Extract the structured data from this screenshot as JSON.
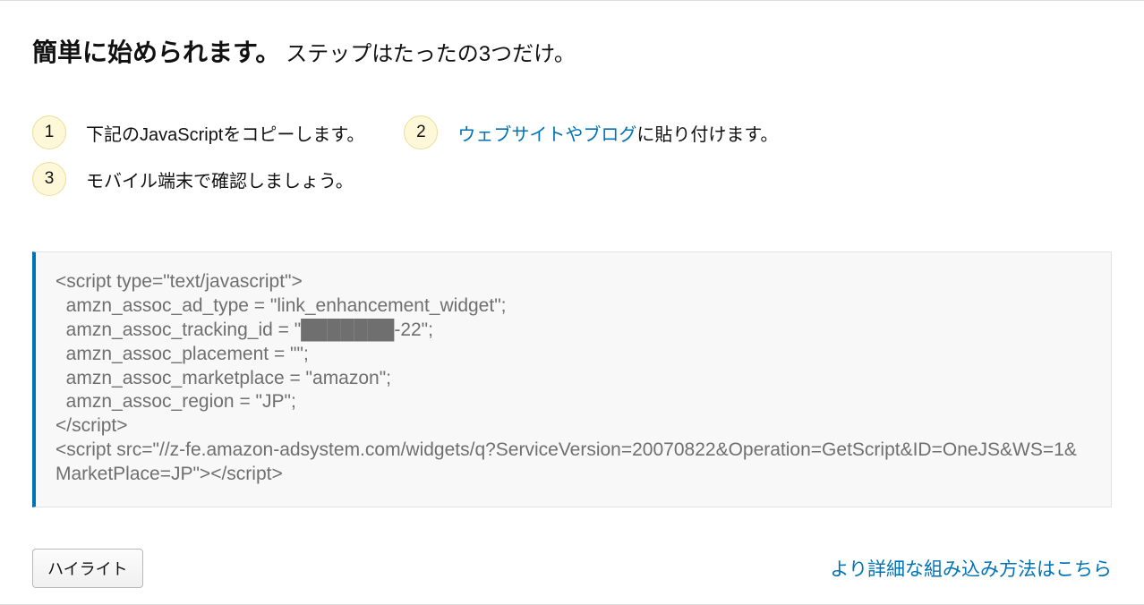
{
  "heading": {
    "main": "簡単に始められます。",
    "sub": "ステップはたったの3つだけ。"
  },
  "steps": {
    "s1": {
      "num": "1",
      "text": "下記のJavaScriptをコピーします。"
    },
    "s2": {
      "num": "2",
      "link": "ウェブサイトやブログ",
      "after": "に貼り付けます。"
    },
    "s3": {
      "num": "3",
      "text": "モバイル端末で確認しましょう。"
    }
  },
  "code": "<script type=\"text/javascript\">\n  amzn_assoc_ad_type = \"link_enhancement_widget\";\n  amzn_assoc_tracking_id = \"███████-22\";\n  amzn_assoc_placement = \"\";\n  amzn_assoc_marketplace = \"amazon\";\n  amzn_assoc_region = \"JP\";\n</script>\n<script src=\"//z-fe.amazon-adsystem.com/widgets/q?ServiceVersion=20070822&Operation=GetScript&ID=OneJS&WS=1&MarketPlace=JP\"></script>",
  "footer": {
    "highlight_button": "ハイライト",
    "more_link": "より詳細な組み込み方法はこちら"
  }
}
